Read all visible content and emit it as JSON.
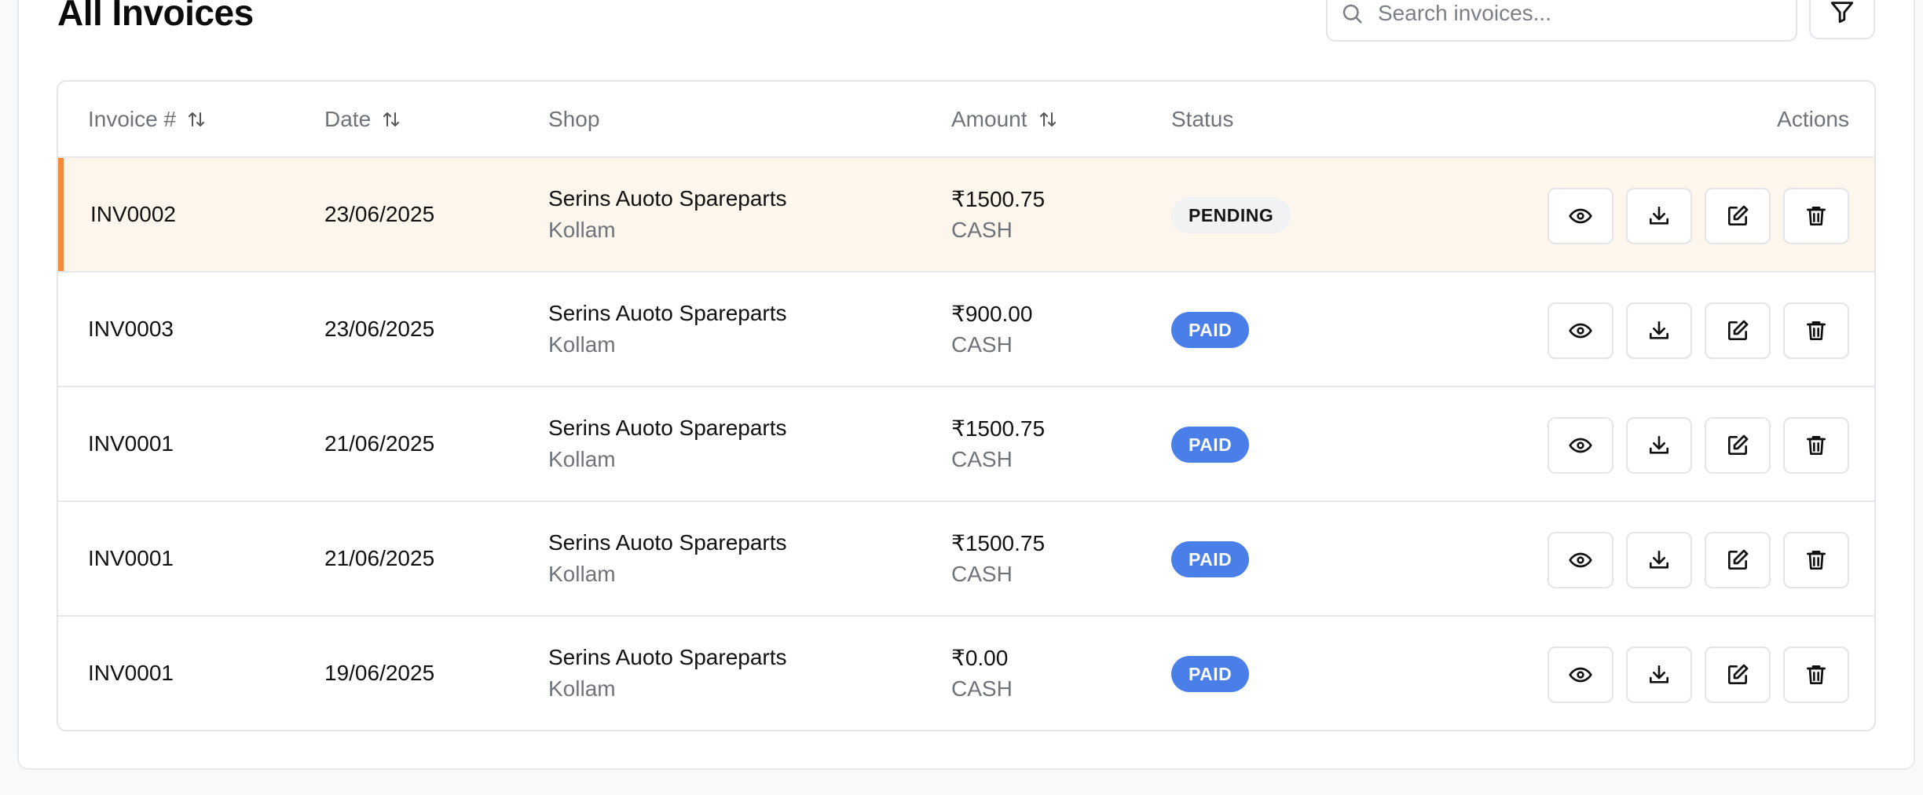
{
  "page": {
    "title": "All Invoices"
  },
  "search": {
    "placeholder": "Search invoices..."
  },
  "table": {
    "headers": {
      "invoice": "Invoice #",
      "date": "Date",
      "shop": "Shop",
      "amount": "Amount",
      "status": "Status",
      "actions": "Actions"
    },
    "rows": [
      {
        "invoice": "INV0002",
        "date": "23/06/2025",
        "shop_name": "Serins Auoto Spareparts",
        "shop_location": "Kollam",
        "amount": "₹1500.75",
        "payment_method": "CASH",
        "status": "PENDING"
      },
      {
        "invoice": "INV0003",
        "date": "23/06/2025",
        "shop_name": "Serins Auoto Spareparts",
        "shop_location": "Kollam",
        "amount": "₹900.00",
        "payment_method": "CASH",
        "status": "PAID"
      },
      {
        "invoice": "INV0001",
        "date": "21/06/2025",
        "shop_name": "Serins Auoto Spareparts",
        "shop_location": "Kollam",
        "amount": "₹1500.75",
        "payment_method": "CASH",
        "status": "PAID"
      },
      {
        "invoice": "INV0001",
        "date": "21/06/2025",
        "shop_name": "Serins Auoto Spareparts",
        "shop_location": "Kollam",
        "amount": "₹1500.75",
        "payment_method": "CASH",
        "status": "PAID"
      },
      {
        "invoice": "INV0001",
        "date": "19/06/2025",
        "shop_name": "Serins Auoto Spareparts",
        "shop_location": "Kollam",
        "amount": "₹0.00",
        "payment_method": "CASH",
        "status": "PAID"
      }
    ]
  },
  "icons": {
    "search": "search-icon",
    "filter": "filter-icon",
    "sort": "sort-icon",
    "view": "eye-icon",
    "download": "download-icon",
    "edit": "edit-icon",
    "delete": "trash-icon"
  },
  "colors": {
    "paid_badge": "#4a7ee8",
    "pending_badge": "#f1f2f4",
    "highlight_row": "#fdf6ec",
    "highlight_accent": "#f08c3c"
  }
}
